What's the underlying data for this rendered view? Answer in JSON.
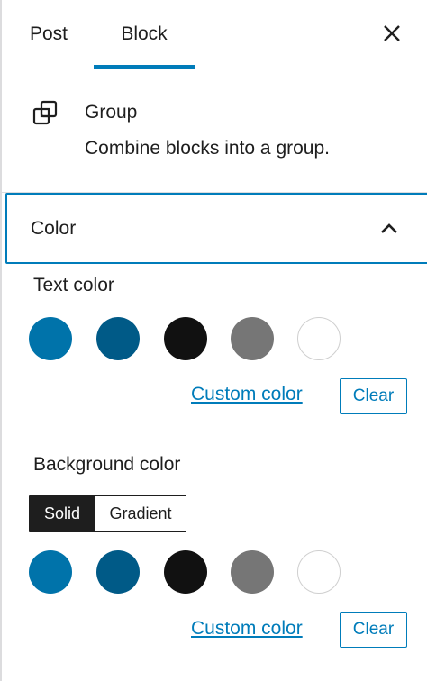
{
  "tabs": {
    "post": "Post",
    "block": "Block"
  },
  "block": {
    "title": "Group",
    "description": "Combine blocks into a group."
  },
  "color_panel": {
    "title": "Color"
  },
  "text_color": {
    "label": "Text color",
    "custom_link": "Custom color",
    "clear": "Clear"
  },
  "background_color": {
    "label": "Background color",
    "tab_solid": "Solid",
    "tab_gradient": "Gradient",
    "custom_link": "Custom color",
    "clear": "Clear"
  },
  "palette": [
    "#0073aa",
    "#005a87",
    "#111111",
    "#767676",
    "#ffffff"
  ],
  "accent": "#007cba"
}
